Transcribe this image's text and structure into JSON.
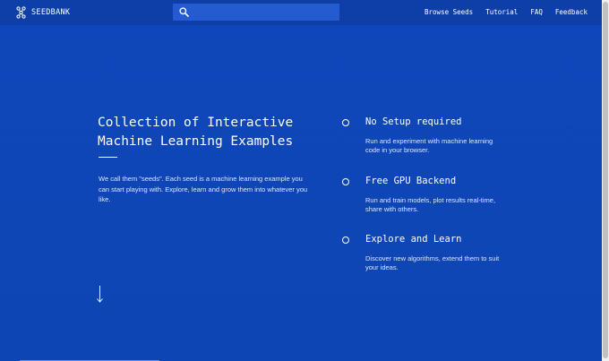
{
  "nav": {
    "brand": "SEEDBANK",
    "brand_icon": "seedbank-logo-icon",
    "search": {
      "icon": "search-icon",
      "placeholder": "",
      "value": ""
    },
    "links": [
      {
        "label": "Browse Seeds"
      },
      {
        "label": "Tutorial"
      },
      {
        "label": "FAQ"
      },
      {
        "label": "Feedback"
      }
    ]
  },
  "hero": {
    "title_line1": "Collection of Interactive",
    "title_line2": "Machine Learning Examples",
    "description": "We call them \"seeds\". Each seed is a machine learning example you can start playing with. Explore, learn and grow them into whatever you like.",
    "scroll_icon": "arrow-down-icon"
  },
  "features": [
    {
      "title": "No Setup required",
      "description": "Run and experiment with machine learning code in your browser."
    },
    {
      "title": "Free GPU Backend",
      "description": "Run and train models, plot results real-time, share with others."
    },
    {
      "title": "Explore and Learn",
      "description": "Discover new algorithms, extend them to suit your ideas."
    }
  ],
  "colors": {
    "background": "#0f45b6",
    "navbar": "#0e3fa8",
    "search_bg": "#245bd0",
    "text": "#ffffff"
  }
}
